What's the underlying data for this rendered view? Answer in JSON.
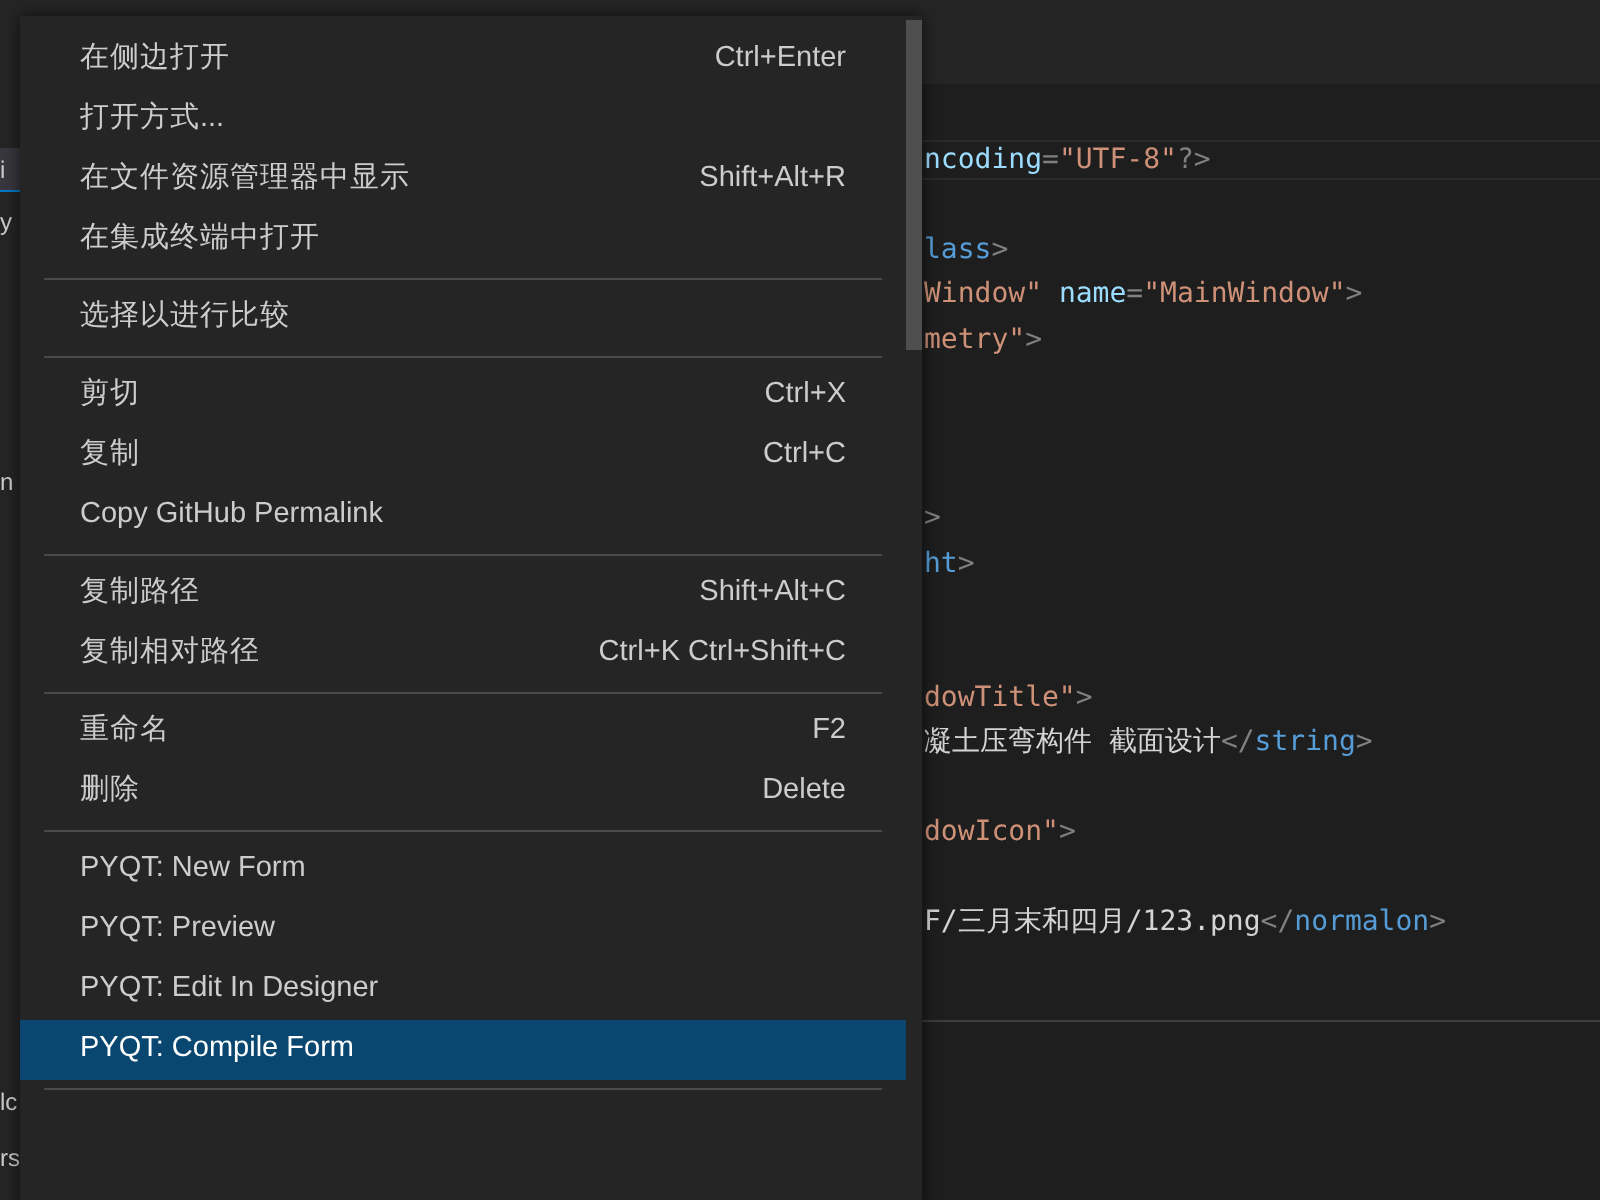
{
  "sidebar_fragments": [
    {
      "text": "i",
      "selected": true
    },
    {
      "text": "y",
      "selected": false
    },
    {
      "text": "n",
      "selected": false
    },
    {
      "text": "lc",
      "selected": false
    },
    {
      "text": "rs",
      "selected": false
    }
  ],
  "editor": {
    "lines": [
      {
        "kind": "code",
        "tokens": [
          {
            "kind": "attr",
            "text": "ncoding"
          },
          {
            "kind": "punct",
            "text": "="
          },
          {
            "kind": "string",
            "text": "\"UTF-8\""
          },
          {
            "kind": "punct",
            "text": "?>"
          }
        ]
      },
      {
        "kind": "blank"
      },
      {
        "kind": "code",
        "tokens": [
          {
            "kind": "tag",
            "text": "lass"
          },
          {
            "kind": "punct",
            "text": ">"
          }
        ]
      },
      {
        "kind": "code",
        "tokens": [
          {
            "kind": "string",
            "text": "Window\""
          },
          {
            "kind": "attr",
            "text": " name"
          },
          {
            "kind": "punct",
            "text": "="
          },
          {
            "kind": "string",
            "text": "\"MainWindow\""
          },
          {
            "kind": "punct",
            "text": ">"
          }
        ]
      },
      {
        "kind": "code",
        "tokens": [
          {
            "kind": "string",
            "text": "metry\""
          },
          {
            "kind": "punct",
            "text": ">"
          }
        ]
      },
      {
        "kind": "blank"
      },
      {
        "kind": "blank"
      },
      {
        "kind": "blank"
      },
      {
        "kind": "code",
        "tokens": [
          {
            "kind": "punct",
            "text": ">"
          }
        ]
      },
      {
        "kind": "code",
        "tokens": [
          {
            "kind": "tag",
            "text": "ht"
          },
          {
            "kind": "punct",
            "text": ">"
          }
        ]
      },
      {
        "kind": "blank"
      },
      {
        "kind": "blank"
      },
      {
        "kind": "code",
        "tokens": [
          {
            "kind": "string",
            "text": "dowTitle\""
          },
          {
            "kind": "punct",
            "text": ">"
          }
        ]
      },
      {
        "kind": "code",
        "tokens": [
          {
            "kind": "text",
            "text": "凝土压弯构件 截面设计"
          },
          {
            "kind": "punct",
            "text": "</"
          },
          {
            "kind": "tag",
            "text": "string"
          },
          {
            "kind": "punct",
            "text": ">"
          }
        ]
      },
      {
        "kind": "blank"
      },
      {
        "kind": "code",
        "tokens": [
          {
            "kind": "string",
            "text": "dowIcon\""
          },
          {
            "kind": "punct",
            "text": ">"
          }
        ]
      },
      {
        "kind": "blank"
      },
      {
        "kind": "code",
        "tokens": [
          {
            "kind": "text",
            "text": "F/三月末和四月/123.png"
          },
          {
            "kind": "punct",
            "text": "</"
          },
          {
            "kind": "tag",
            "text": "normalon"
          },
          {
            "kind": "punct",
            "text": ">"
          }
        ]
      }
    ]
  },
  "context_menu": {
    "groups": [
      [
        {
          "label": "在侧边打开",
          "shortcut": "Ctrl+Enter",
          "selected": false
        },
        {
          "label": "打开方式...",
          "selected": false
        },
        {
          "label": "在文件资源管理器中显示",
          "shortcut": "Shift+Alt+R",
          "selected": false
        },
        {
          "label": "在集成终端中打开",
          "selected": false
        }
      ],
      [
        {
          "label": "选择以进行比较",
          "selected": false
        }
      ],
      [
        {
          "label": "剪切",
          "shortcut": "Ctrl+X",
          "selected": false
        },
        {
          "label": "复制",
          "shortcut": "Ctrl+C",
          "selected": false
        },
        {
          "label": "Copy GitHub Permalink",
          "selected": false
        }
      ],
      [
        {
          "label": "复制路径",
          "shortcut": "Shift+Alt+C",
          "selected": false
        },
        {
          "label": "复制相对路径",
          "shortcut": "Ctrl+K Ctrl+Shift+C",
          "selected": false
        }
      ],
      [
        {
          "label": "重命名",
          "shortcut": "F2",
          "selected": false
        },
        {
          "label": "删除",
          "shortcut": "Delete",
          "selected": false
        }
      ],
      [
        {
          "label": "PYQT: New Form",
          "selected": false
        },
        {
          "label": "PYQT: Preview",
          "selected": false
        },
        {
          "label": "PYQT: Edit In Designer",
          "selected": false
        },
        {
          "label": "PYQT: Compile Form",
          "selected": true
        }
      ]
    ]
  }
}
